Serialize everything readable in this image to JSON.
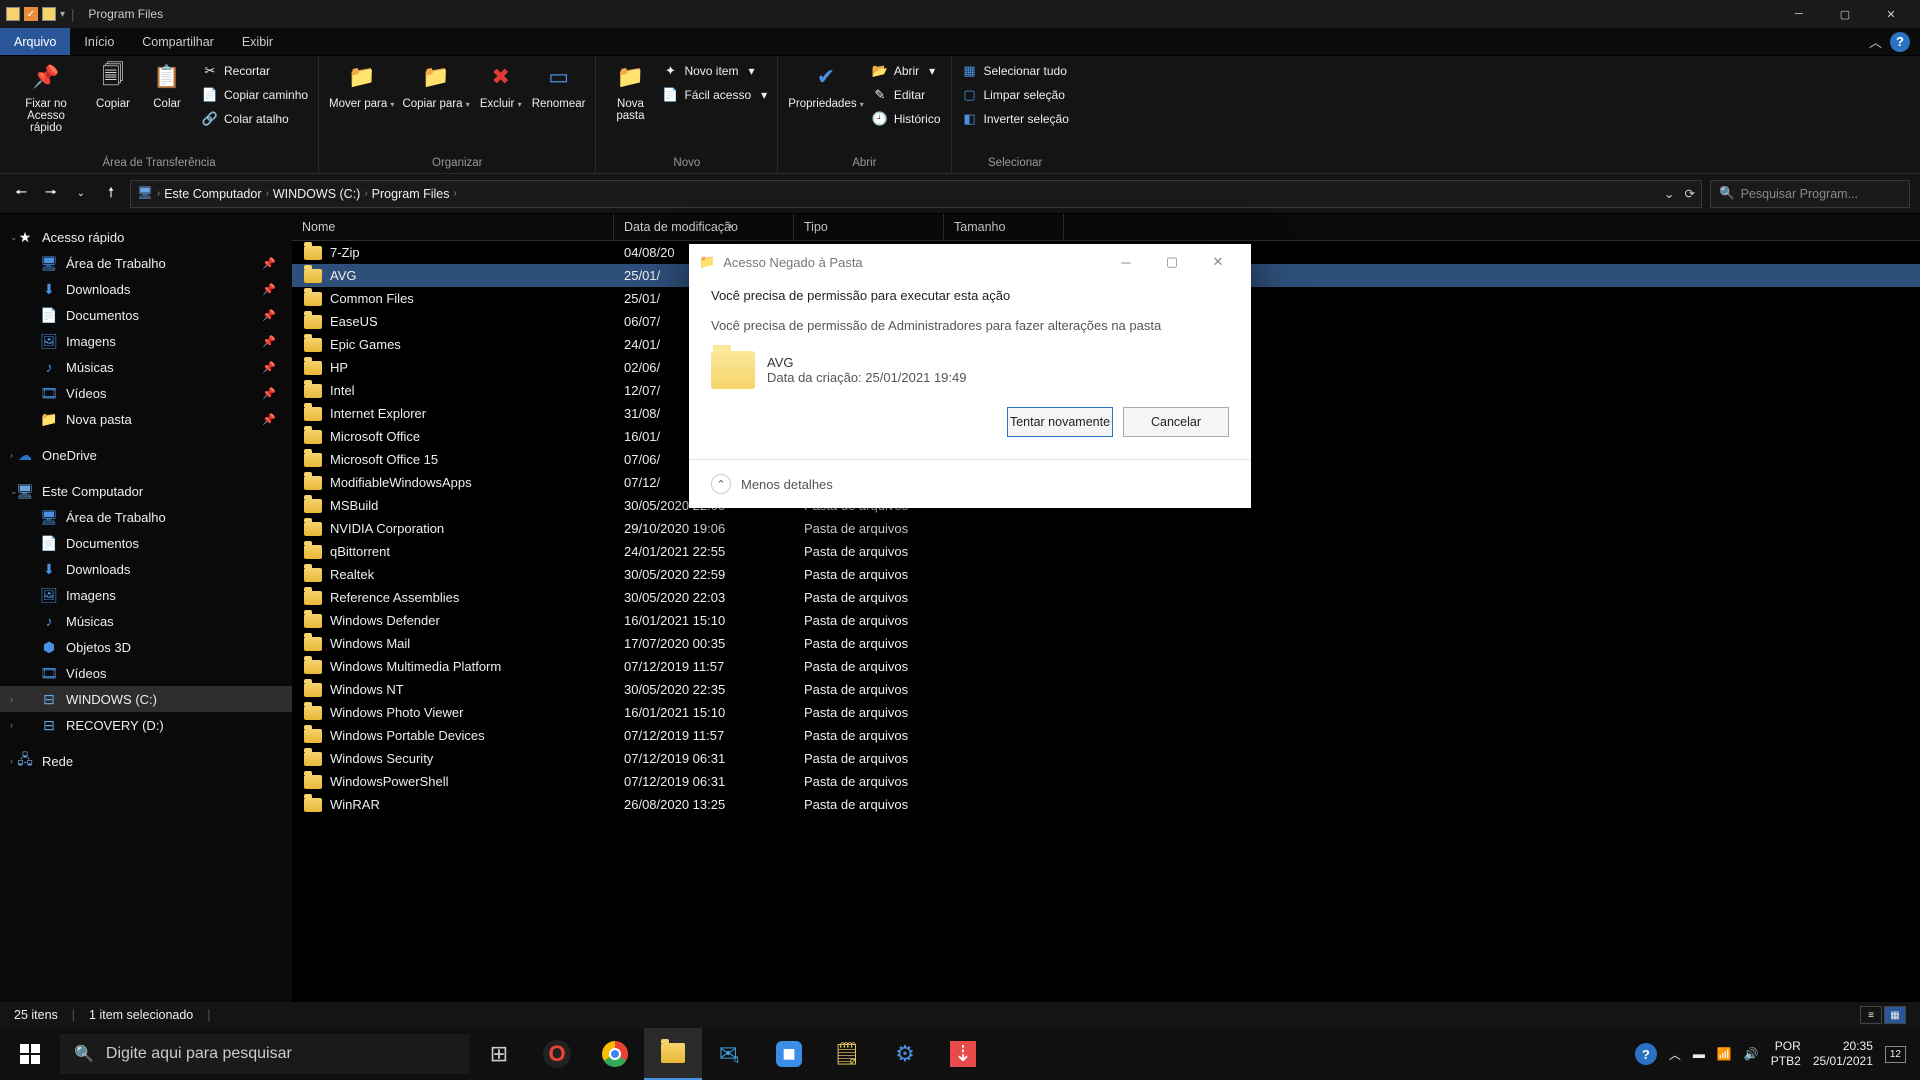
{
  "window": {
    "title": "Program Files"
  },
  "ribbon_tabs": {
    "file": "Arquivo",
    "home": "Início",
    "share": "Compartilhar",
    "view": "Exibir"
  },
  "ribbon": {
    "clipboard": {
      "pin": "Fixar no Acesso rápido",
      "copy": "Copiar",
      "paste": "Colar",
      "cut": "Recortar",
      "copy_path": "Copiar caminho",
      "paste_shortcut": "Colar atalho",
      "group": "Área de Transferência"
    },
    "organize": {
      "move_to": "Mover para",
      "copy_to": "Copiar para",
      "delete": "Excluir",
      "rename": "Renomear",
      "group": "Organizar"
    },
    "new": {
      "new_folder": "Nova pasta",
      "new_item": "Novo item",
      "easy_access": "Fácil acesso",
      "group": "Novo"
    },
    "open": {
      "properties": "Propriedades",
      "open": "Abrir",
      "edit": "Editar",
      "history": "Histórico",
      "group": "Abrir"
    },
    "select": {
      "select_all": "Selecionar tudo",
      "select_none": "Limpar seleção",
      "invert": "Inverter seleção",
      "group": "Selecionar"
    }
  },
  "breadcrumb": {
    "this_pc": "Este Computador",
    "drive": "WINDOWS (C:)",
    "folder": "Program Files"
  },
  "search": {
    "placeholder": "Pesquisar Program..."
  },
  "sidebar": {
    "quick_access": "Acesso rápido",
    "desktop": "Área de Trabalho",
    "downloads": "Downloads",
    "documents": "Documentos",
    "pictures": "Imagens",
    "music": "Músicas",
    "videos": "Vídeos",
    "new_folder": "Nova pasta",
    "onedrive": "OneDrive",
    "this_pc": "Este Computador",
    "objects3d": "Objetos 3D",
    "drive_c": "WINDOWS (C:)",
    "drive_d": "RECOVERY (D:)",
    "network": "Rede"
  },
  "columns": {
    "name": "Nome",
    "date": "Data de modificação",
    "type": "Tipo",
    "size": "Tamanho"
  },
  "file_type": "Pasta de arquivos",
  "files": [
    {
      "name": "7-Zip",
      "date": "04/08/20"
    },
    {
      "name": "AVG",
      "date": "25/01/"
    },
    {
      "name": "Common Files",
      "date": "25/01/"
    },
    {
      "name": "EaseUS",
      "date": "06/07/"
    },
    {
      "name": "Epic Games",
      "date": "24/01/"
    },
    {
      "name": "HP",
      "date": "02/06/"
    },
    {
      "name": "Intel",
      "date": "12/07/"
    },
    {
      "name": "Internet Explorer",
      "date": "31/08/"
    },
    {
      "name": "Microsoft Office",
      "date": "16/01/"
    },
    {
      "name": "Microsoft Office 15",
      "date": "07/06/"
    },
    {
      "name": "ModifiableWindowsApps",
      "date": "07/12/"
    },
    {
      "name": "MSBuild",
      "date": "30/05/2020 22:03",
      "full": true
    },
    {
      "name": "NVIDIA Corporation",
      "date": "29/10/2020 19:06",
      "full": true
    },
    {
      "name": "qBittorrent",
      "date": "24/01/2021 22:55",
      "full": true
    },
    {
      "name": "Realtek",
      "date": "30/05/2020 22:59",
      "full": true
    },
    {
      "name": "Reference Assemblies",
      "date": "30/05/2020 22:03",
      "full": true
    },
    {
      "name": "Windows Defender",
      "date": "16/01/2021 15:10",
      "full": true
    },
    {
      "name": "Windows Mail",
      "date": "17/07/2020 00:35",
      "full": true
    },
    {
      "name": "Windows Multimedia Platform",
      "date": "07/12/2019 11:57",
      "full": true
    },
    {
      "name": "Windows NT",
      "date": "30/05/2020 22:35",
      "full": true
    },
    {
      "name": "Windows Photo Viewer",
      "date": "16/01/2021 15:10",
      "full": true
    },
    {
      "name": "Windows Portable Devices",
      "date": "07/12/2019 11:57",
      "full": true
    },
    {
      "name": "Windows Security",
      "date": "07/12/2019 06:31",
      "full": true
    },
    {
      "name": "WindowsPowerShell",
      "date": "07/12/2019 06:31",
      "full": true
    },
    {
      "name": "WinRAR",
      "date": "26/08/2020 13:25",
      "full": true
    }
  ],
  "status": {
    "items": "25 itens",
    "selected": "1 item selecionado"
  },
  "dialog": {
    "title": "Acesso Negado à Pasta",
    "line1": "Você precisa de permissão para executar esta ação",
    "line2": "Você precisa de permissão de Administradores para fazer alterações na pasta",
    "folder_name": "AVG",
    "created": "Data da criação: 25/01/2021 19:49",
    "retry": "Tentar novamente",
    "cancel": "Cancelar",
    "more": "Menos detalhes"
  },
  "taskbar": {
    "search": "Digite aqui para pesquisar",
    "lang1": "POR",
    "lang2": "PTB2",
    "time": "20:35",
    "date": "25/01/2021"
  }
}
